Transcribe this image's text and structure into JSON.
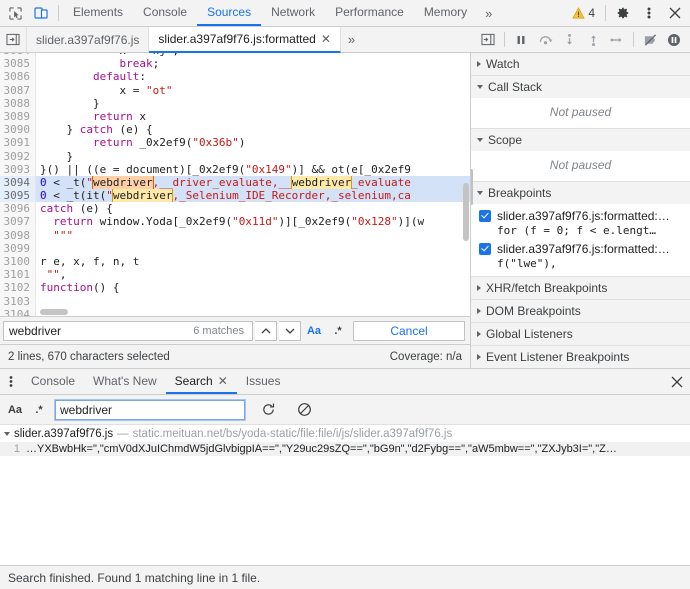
{
  "toolbar": {
    "inspect_icon": "inspect-element-icon",
    "device_icon": "device-toolbar-icon",
    "tabs": [
      {
        "label": "Elements",
        "active": false
      },
      {
        "label": "Console",
        "active": false
      },
      {
        "label": "Sources",
        "active": true
      },
      {
        "label": "Network",
        "active": false
      },
      {
        "label": "Performance",
        "active": false
      },
      {
        "label": "Memory",
        "active": false
      }
    ],
    "overflow_label": "»",
    "warning_count": "4",
    "settings_icon": "gear-icon",
    "more_icon": "kebab-menu-icon",
    "close_icon": "close-icon"
  },
  "file_tabs": {
    "navigator_icon": "show-navigator-icon",
    "tabs": [
      {
        "label": "slider.a397af9f76.js",
        "active": false,
        "closable": false
      },
      {
        "label": "slider.a397af9f76.js:formatted",
        "active": true,
        "closable": true
      }
    ],
    "close_glyph": "✕",
    "overflow_label": "»"
  },
  "debug_controls": {
    "show_debugger_icon": "show-debugger-sidebar-icon",
    "pause_icon": "pause-script-icon",
    "step_over_icon": "step-over-icon",
    "step_into_icon": "step-into-icon",
    "step_out_icon": "step-out-icon",
    "step_icon": "step-icon",
    "deactivate_breakpoints_icon": "deactivate-breakpoints-icon",
    "pause_exceptions_icon": "pause-on-exceptions-icon"
  },
  "editor": {
    "lines": [
      {
        "no": "3084",
        "selected": false,
        "partial": true,
        "tokens": [
          {
            "t": "            x = \"nj\";",
            "c": "t-def"
          }
        ]
      },
      {
        "no": "3085",
        "selected": false,
        "tokens": [
          {
            "t": "            ",
            "c": "t-def"
          },
          {
            "t": "break",
            "c": "t-kw"
          },
          {
            "t": ";",
            "c": "t-def"
          }
        ]
      },
      {
        "no": "3086",
        "selected": false,
        "tokens": [
          {
            "t": "        ",
            "c": "t-def"
          },
          {
            "t": "default",
            "c": "t-kw"
          },
          {
            "t": ":",
            "c": "t-def"
          }
        ]
      },
      {
        "no": "3087",
        "selected": false,
        "tokens": [
          {
            "t": "            x = ",
            "c": "t-def"
          },
          {
            "t": "\"ot\"",
            "c": "t-str"
          }
        ]
      },
      {
        "no": "3088",
        "selected": false,
        "tokens": [
          {
            "t": "        }",
            "c": "t-def"
          }
        ]
      },
      {
        "no": "3089",
        "selected": false,
        "tokens": [
          {
            "t": "        ",
            "c": "t-def"
          },
          {
            "t": "return",
            "c": "t-kw"
          },
          {
            "t": " x",
            "c": "t-def"
          }
        ]
      },
      {
        "no": "3090",
        "selected": false,
        "tokens": [
          {
            "t": "    } ",
            "c": "t-def"
          },
          {
            "t": "catch",
            "c": "t-kw"
          },
          {
            "t": " (e) {",
            "c": "t-def"
          }
        ]
      },
      {
        "no": "3091",
        "selected": false,
        "tokens": [
          {
            "t": "        ",
            "c": "t-def"
          },
          {
            "t": "return",
            "c": "t-kw"
          },
          {
            "t": " _0x2ef9(",
            "c": "t-def"
          },
          {
            "t": "\"0x36b\"",
            "c": "t-str"
          },
          {
            "t": ")",
            "c": "t-def"
          }
        ]
      },
      {
        "no": "3092",
        "selected": false,
        "tokens": [
          {
            "t": "    }",
            "c": "t-def"
          }
        ]
      },
      {
        "no": "3093",
        "selected": false,
        "tokens": [
          {
            "t": "}() || ((e = document)[_0x2ef9(",
            "c": "t-def"
          },
          {
            "t": "\"0x149\"",
            "c": "t-str"
          },
          {
            "t": ")] && ot(e[_0x2ef9",
            "c": "t-def"
          }
        ]
      },
      {
        "no": "3094",
        "selected": true,
        "tokens": [
          {
            "t": "0",
            "c": "t-num"
          },
          {
            "t": " < _t(",
            "c": "t-def"
          },
          {
            "t": "\"",
            "c": "t-str"
          },
          {
            "t": "webdriver",
            "c": "match-active"
          },
          {
            "t": ",__driver_evaluate,__",
            "c": "t-str"
          },
          {
            "t": "webdriver",
            "c": "match"
          },
          {
            "t": "_evaluate",
            "c": "t-str"
          }
        ]
      },
      {
        "no": "3095",
        "selected": true,
        "tokens": [
          {
            "t": "0",
            "c": "t-num"
          },
          {
            "t": " < _t(it(",
            "c": "t-def"
          },
          {
            "t": "\"",
            "c": "t-str"
          },
          {
            "t": "webdriver",
            "c": "match"
          },
          {
            "t": ",_Selenium_IDE_Recorder,_selenium,ca",
            "c": "t-str"
          }
        ]
      },
      {
        "no": "3096",
        "selected": false,
        "tokens": [
          {
            "t": "catch",
            "c": "t-kw"
          },
          {
            "t": " (e) {",
            "c": "t-def"
          }
        ]
      },
      {
        "no": "3097",
        "selected": false,
        "tokens": [
          {
            "t": "  ",
            "c": "t-def"
          },
          {
            "t": "return",
            "c": "t-kw"
          },
          {
            "t": " window.Yoda[_0x2ef9(",
            "c": "t-def"
          },
          {
            "t": "\"0x11d\"",
            "c": "t-str"
          },
          {
            "t": ")][_0x2ef9(",
            "c": "t-def"
          },
          {
            "t": "\"0x128\"",
            "c": "t-str"
          },
          {
            "t": ")](w",
            "c": "t-def"
          }
        ]
      },
      {
        "no": "3098",
        "selected": false,
        "tokens": [
          {
            "t": "  ",
            "c": "t-def"
          },
          {
            "t": "\"\"\"",
            "c": "t-str"
          }
        ]
      },
      {
        "no": "3099",
        "selected": false,
        "tokens": [
          {
            "t": "",
            "c": "t-def"
          }
        ]
      },
      {
        "no": "3100",
        "selected": false,
        "tokens": [
          {
            "t": "r e, x, f, n, t",
            "c": "t-def"
          }
        ]
      },
      {
        "no": "3101",
        "selected": false,
        "tokens": [
          {
            "t": " ",
            "c": "t-def"
          },
          {
            "t": "\"\"",
            "c": "t-str"
          },
          {
            "t": ",",
            "c": "t-def"
          }
        ]
      },
      {
        "no": "3102",
        "selected": false,
        "tokens": [
          {
            "t": "function",
            "c": "t-kw"
          },
          {
            "t": "() {",
            "c": "t-def"
          }
        ]
      },
      {
        "no": "3103",
        "selected": false,
        "tokens": [
          {
            "t": "",
            "c": "t-def"
          }
        ]
      },
      {
        "no": "3104",
        "selected": false,
        "tokens": [
          {
            "t": "",
            "c": "t-def"
          }
        ]
      }
    ],
    "find": {
      "query": "webdriver",
      "placeholder": "Find",
      "matches_label": "6 matches",
      "prev_glyph": "∧",
      "next_glyph": "∨",
      "match_case_label": "Aa",
      "regex_label": ".*",
      "cancel_label": "Cancel"
    },
    "status": {
      "selection_info": "2 lines, 670 characters selected",
      "coverage": "Coverage: n/a"
    }
  },
  "sidebar": {
    "sections": [
      {
        "title": "Watch",
        "expanded": false,
        "body_type": "none"
      },
      {
        "title": "Call Stack",
        "expanded": true,
        "body_type": "notpaused",
        "empty_text": "Not paused"
      },
      {
        "title": "Scope",
        "expanded": true,
        "body_type": "notpaused",
        "empty_text": "Not paused"
      },
      {
        "title": "Breakpoints",
        "expanded": true,
        "body_type": "breakpoints"
      },
      {
        "title": "XHR/fetch Breakpoints",
        "expanded": false,
        "body_type": "none"
      },
      {
        "title": "DOM Breakpoints",
        "expanded": false,
        "body_type": "none"
      },
      {
        "title": "Global Listeners",
        "expanded": false,
        "body_type": "none"
      },
      {
        "title": "Event Listener Breakpoints",
        "expanded": false,
        "body_type": "none"
      }
    ],
    "breakpoints": [
      {
        "checked": true,
        "title": "slider.a397af9f76.js:formatted:…",
        "snippet": "for (f = 0; f < e.lengt…"
      },
      {
        "checked": true,
        "title": "slider.a397af9f76.js:formatted:…",
        "snippet": "f(\"lwe\"),"
      }
    ]
  },
  "drawer": {
    "menu_icon": "kebab-menu-icon",
    "tabs": [
      {
        "label": "Console",
        "active": false,
        "closable": false
      },
      {
        "label": "What's New",
        "active": false,
        "closable": false
      },
      {
        "label": "Search",
        "active": true,
        "closable": true
      },
      {
        "label": "Issues",
        "active": false,
        "closable": false
      }
    ],
    "close_glyph": "✕",
    "close_drawer_icon": "close-icon",
    "search": {
      "match_case_label": "Aa",
      "regex_label": ".*",
      "query": "webdriver",
      "placeholder": "Search",
      "refresh_icon": "refresh-icon",
      "clear_icon": "clear-icon"
    },
    "results": {
      "file_name": "slider.a397af9f76.js",
      "dash": "—",
      "file_url": "static.meituan.net/bs/yoda-static/file:file/i/js/slider.a397af9f76.js",
      "matches": [
        {
          "line_no": "1",
          "text": "…YXBwbHk=\",\"cmV0dXJuIChmdW5jdGlvbigpIA==\",\"Y29uc29sZQ==\",\"bG9n\",\"d2Fybg==\",\"aW5mbw==\",\"ZXJyb3I=\",\"Z…"
        }
      ]
    }
  },
  "status_bar": {
    "message": "Search finished. Found 1 matching line in 1 file."
  },
  "colors": {
    "accent": "#1a73e8",
    "warning": "#e8a33d",
    "selection": "#d4e2f7",
    "match": "#ffe9a8",
    "match_active": "#ffd0a8"
  }
}
